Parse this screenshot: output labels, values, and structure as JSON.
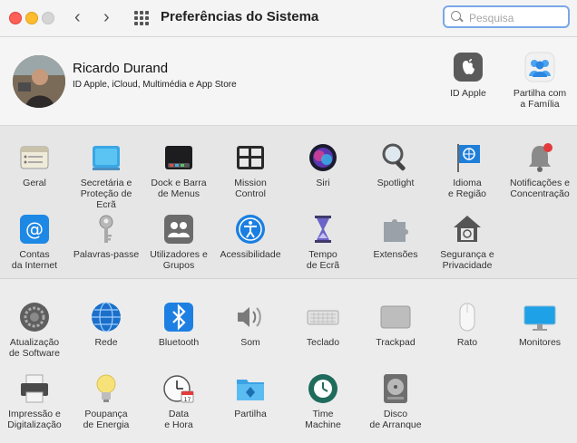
{
  "window": {
    "title": "Preferências do Sistema",
    "search_placeholder": "Pesquisa",
    "back": "‹",
    "forward": "›"
  },
  "account": {
    "name": "Ricardo Durand",
    "subtitle": "ID Apple, iCloud, Multimédia e App Store",
    "items": [
      {
        "label": "ID Apple",
        "icon": "apple-id-icon"
      },
      {
        "label": "Partilha com\na Família",
        "icon": "family-sharing-icon"
      }
    ]
  },
  "section1": [
    {
      "label": "Geral",
      "icon": "general-icon"
    },
    {
      "label": "Secretária e\nProteção de Ecrã",
      "icon": "desktop-screensaver-icon"
    },
    {
      "label": "Dock e Barra\nde Menus",
      "icon": "dock-menubar-icon"
    },
    {
      "label": "Mission\nControl",
      "icon": "mission-control-icon"
    },
    {
      "label": "Siri",
      "icon": "siri-icon"
    },
    {
      "label": "Spotlight",
      "icon": "spotlight-icon"
    },
    {
      "label": "Idioma\ne Região",
      "icon": "language-region-icon"
    },
    {
      "label": "Notificações e\nConcentração",
      "icon": "notifications-icon"
    },
    {
      "label": "Contas\nda Internet",
      "icon": "internet-accounts-icon"
    },
    {
      "label": "Palavras-passe",
      "icon": "passwords-icon"
    },
    {
      "label": "Utilizadores e\nGrupos",
      "icon": "users-groups-icon"
    },
    {
      "label": "Acessibilidade",
      "icon": "accessibility-icon"
    },
    {
      "label": "Tempo\nde Ecrã",
      "icon": "screen-time-icon"
    },
    {
      "label": "Extensões",
      "icon": "extensions-icon"
    },
    {
      "label": "Segurança e\nPrivacidade",
      "icon": "security-privacy-icon"
    }
  ],
  "section2": [
    {
      "label": "Atualização\nde Software",
      "icon": "software-update-icon"
    },
    {
      "label": "Rede",
      "icon": "network-icon"
    },
    {
      "label": "Bluetooth",
      "icon": "bluetooth-icon"
    },
    {
      "label": "Som",
      "icon": "sound-icon"
    },
    {
      "label": "Teclado",
      "icon": "keyboard-icon"
    },
    {
      "label": "Trackpad",
      "icon": "trackpad-icon"
    },
    {
      "label": "Rato",
      "icon": "mouse-icon"
    },
    {
      "label": "Monitores",
      "icon": "displays-icon"
    },
    {
      "label": "Impressão e\nDigitalização",
      "icon": "printers-scanners-icon"
    },
    {
      "label": "Poupança\nde Energia",
      "icon": "energy-saver-icon"
    },
    {
      "label": "Data\ne Hora",
      "icon": "date-time-icon"
    },
    {
      "label": "Partilha",
      "icon": "sharing-icon"
    },
    {
      "label": "Time\nMachine",
      "icon": "time-machine-icon"
    },
    {
      "label": "Disco\nde Arranque",
      "icon": "startup-disk-icon"
    }
  ]
}
